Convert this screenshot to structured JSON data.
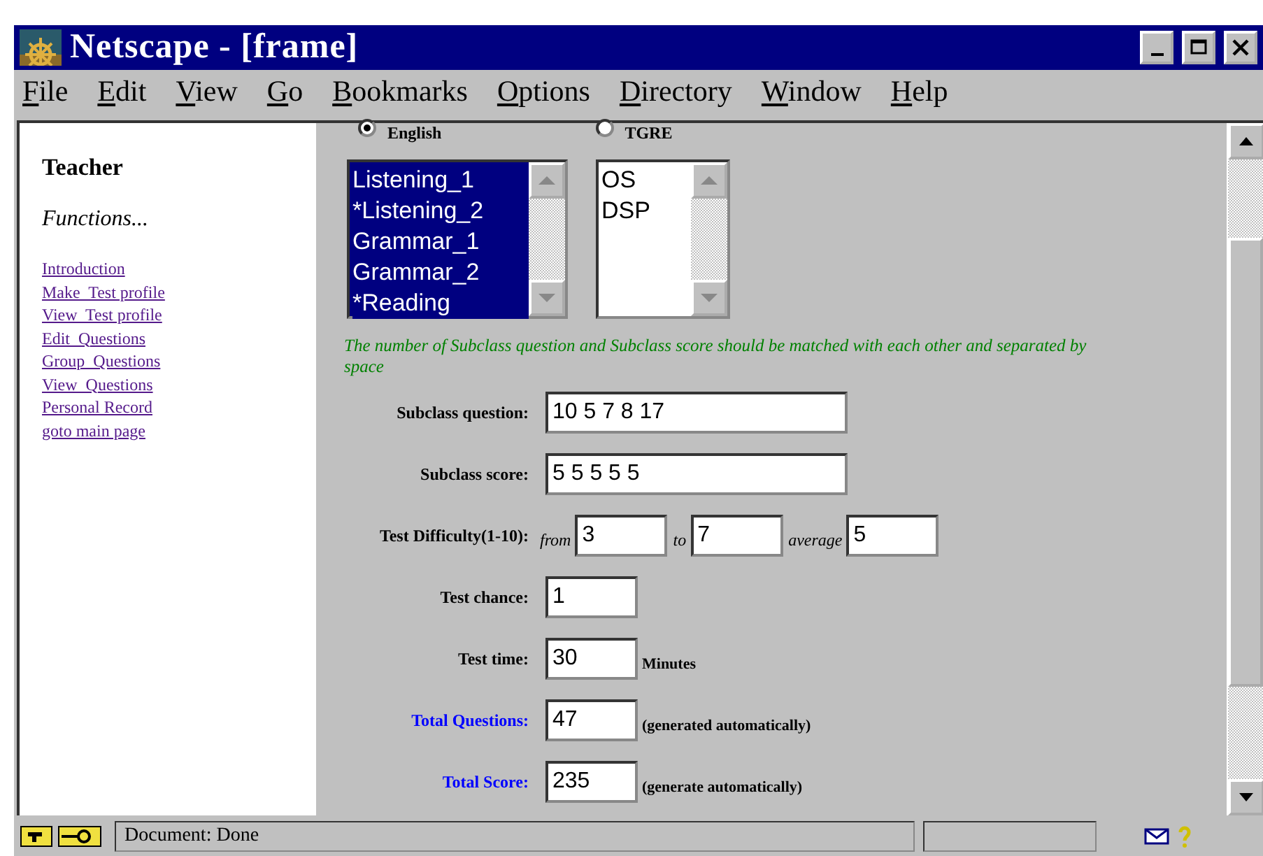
{
  "window": {
    "title": "Netscape - [frame]"
  },
  "menu": [
    "File",
    "Edit",
    "View",
    "Go",
    "Bookmarks",
    "Options",
    "Directory",
    "Window",
    "Help"
  ],
  "sidebar": {
    "heading": "Teacher",
    "subheading": "Functions...",
    "links": [
      "Introduction",
      "Make  Test profile",
      "View  Test profile",
      "Edit  Questions",
      "Group  Questions",
      "View  Questions",
      "Personal Record",
      "goto main page"
    ]
  },
  "languages": [
    {
      "label": "English",
      "selected": true
    },
    {
      "label": "TGRE",
      "selected": false
    }
  ],
  "lists": [
    {
      "items": [
        {
          "label": "Listening_1",
          "selected": true
        },
        {
          "label": "*Listening_2",
          "selected": true
        },
        {
          "label": "Grammar_1",
          "selected": true
        },
        {
          "label": "Grammar_2",
          "selected": true
        },
        {
          "label": "*Reading",
          "selected": true
        }
      ]
    },
    {
      "items": [
        {
          "label": "OS",
          "selected": false
        },
        {
          "label": "DSP",
          "selected": false
        }
      ]
    }
  ],
  "note": "The number of Subclass question and Subclass score should be matched with each other and separated by space",
  "rows": [
    {
      "kind": "wide",
      "label": "Subclass question:",
      "value": "10 5 7 8 17",
      "highlighted": false
    },
    {
      "kind": "wide",
      "label": "Subclass score:",
      "value": "5 5 5 5 5",
      "highlighted": false
    },
    {
      "kind": "range",
      "label": "Test Difficulty(1-10):",
      "highlighted": false,
      "parts": [
        {
          "prefix": "from",
          "value": "3"
        },
        {
          "prefix": "to",
          "value": "7"
        },
        {
          "prefix": "average",
          "value": "5"
        }
      ]
    },
    {
      "kind": "short",
      "label": "Test chance:",
      "value": "1",
      "highlighted": false
    },
    {
      "kind": "short",
      "label": "Test time:",
      "value": "30",
      "suffix": "Minutes",
      "highlighted": false
    },
    {
      "kind": "short",
      "label": "Total Questions:",
      "value": "47",
      "suffix": "(generated automatically)",
      "highlighted": true
    },
    {
      "kind": "short",
      "label": "Total Score:",
      "value": "235",
      "suffix": "(generate automatically)",
      "highlighted": true
    }
  ],
  "status_bar": {
    "text": "Document: Done"
  }
}
